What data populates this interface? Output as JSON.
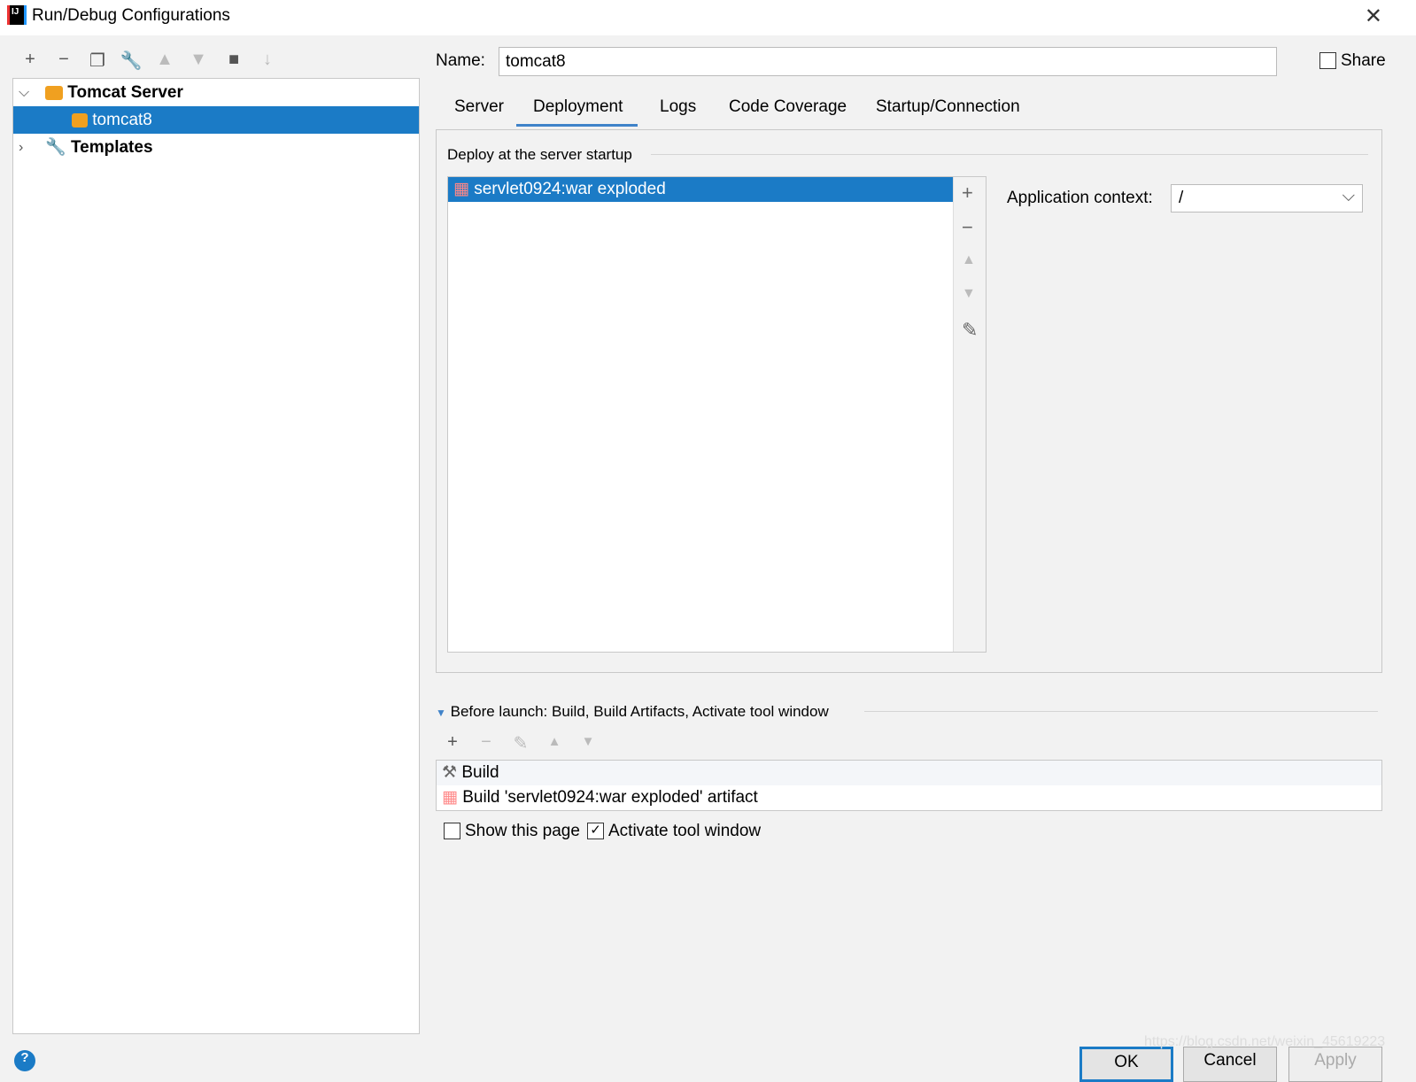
{
  "window": {
    "title": "Run/Debug Configurations"
  },
  "toolbar": {
    "icons": [
      "plus-icon",
      "minus-icon",
      "copy-icon",
      "wrench-icon",
      "arrow-up-icon",
      "arrow-down-icon",
      "folder-add-icon",
      "sort-az-icon"
    ]
  },
  "tree": {
    "items": [
      {
        "label": "Tomcat Server",
        "expanded": true
      },
      {
        "label": "tomcat8",
        "selected": true
      },
      {
        "label": "Templates",
        "expanded": false
      }
    ]
  },
  "name": {
    "label": "Name:",
    "value": "tomcat8"
  },
  "share": {
    "label": "Share",
    "checked": false
  },
  "tabs": [
    "Server",
    "Deployment",
    "Logs",
    "Code Coverage",
    "Startup/Connection"
  ],
  "active_tab": "Deployment",
  "deploy": {
    "section": "Deploy at the server startup",
    "items": [
      "servlet0924:war exploded"
    ],
    "context_label": "Application context:",
    "context_value": "/"
  },
  "before_launch": {
    "title": "Before launch: Build, Build Artifacts, Activate tool window",
    "items": [
      "Build",
      "Build 'servlet0924:war exploded' artifact"
    ]
  },
  "show_page": {
    "label": "Show this page",
    "checked": false
  },
  "activate": {
    "label": "Activate tool window",
    "checked": true
  },
  "buttons": {
    "ok": "OK",
    "cancel": "Cancel",
    "apply": "Apply"
  },
  "watermark": "https://blog.csdn.net/weixin_45619223",
  "colors": {
    "selection": "#1b7bc6",
    "tab_underline": "#4083c9"
  }
}
